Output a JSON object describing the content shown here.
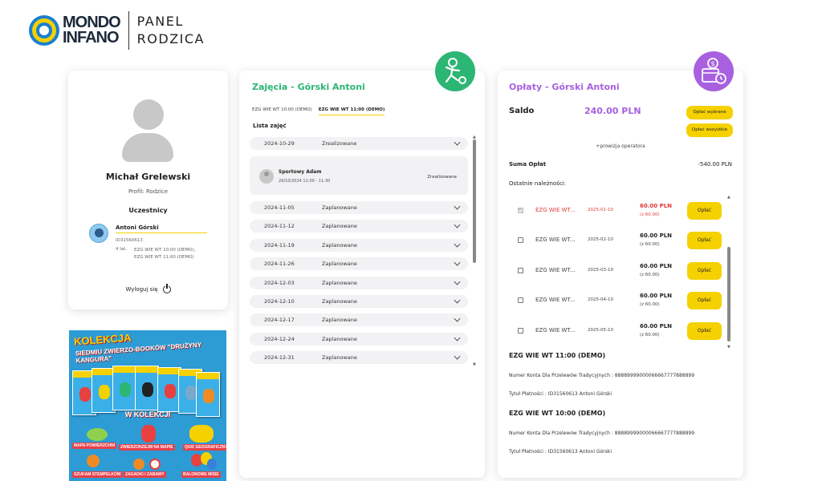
{
  "header": {
    "logo_line1": "MONDO",
    "logo_line2": "INFANO",
    "panel_line1": "PANEL",
    "panel_line2": "RODZICA"
  },
  "profile": {
    "name": "Michał Grelewski",
    "role": "Profil: Rodzice",
    "participants_label": "Uczestnicy",
    "child": {
      "name": "Antoni Górski",
      "id": "ID31560613",
      "age": "4 lat,",
      "groups_line1": "EZG WIE WT 10:00 (DEMO),",
      "groups_line2": "EZG WIE WT 11:00 (DEMO)"
    },
    "logout": "Wyloguj się"
  },
  "ad": {
    "title": "KOLEKCJA",
    "subtitle": "SIEDMIU ZWIERZO-BOOKÓW \"DRUŻYNY KANGURA\"",
    "in_collection": "W KOLEKCJI",
    "items": [
      "MAPA POWIERZCHNI",
      "ZWIERZONZEJM NA MAPIE",
      "QUIZ GEOGRAFICZNY",
      "SZUKAM STEMPELKÓW",
      "ZAGADKI I ZABAWY",
      "BALONOWE MISIE"
    ]
  },
  "classes": {
    "title": "Zajęcia - Górski Antoni",
    "tabs": [
      {
        "label": "EZG WIE WT 10:00 (DEMO)",
        "active": false
      },
      {
        "label": "EZG WIE WT 11:00 (DEMO)",
        "active": true
      }
    ],
    "list_label": "Lista zajęć",
    "expanded": {
      "teacher": "Sportowy Adam",
      "time": "29/10/2024 11:00 - 11:30",
      "status": "Zrealizowane"
    },
    "rows": [
      {
        "date": "2024-10-29",
        "status": "Zrealizowane"
      },
      {
        "date": "2024-11-05",
        "status": "Zaplanowane"
      },
      {
        "date": "2024-11-12",
        "status": "Zaplanowane"
      },
      {
        "date": "2024-11-19",
        "status": "Zaplanowane"
      },
      {
        "date": "2024-11-26",
        "status": "Zaplanowane"
      },
      {
        "date": "2024-12-03",
        "status": "Zaplanowane"
      },
      {
        "date": "2024-12-10",
        "status": "Zaplanowane"
      },
      {
        "date": "2024-12-17",
        "status": "Zaplanowane"
      },
      {
        "date": "2024-12-24",
        "status": "Zaplanowane"
      },
      {
        "date": "2024-12-31",
        "status": "Zaplanowane"
      }
    ]
  },
  "fees": {
    "title": "Opłaty - Górski Antoni",
    "saldo_label": "Saldo",
    "saldo_value": "240.00 PLN",
    "btn_selected": "Opłać wybrane",
    "btn_all": "Opłać wszystkie",
    "note": "+prowizja operatora",
    "suma_label": "Suma Opłat",
    "suma_value": "-540.00 PLN",
    "recent_label": "Ostatnie należności:",
    "pay_label": "Opłać",
    "items": [
      {
        "name": "EZG WIE WT...",
        "date": "2025-01-10",
        "amount": "60.00 PLN",
        "sub": "(z 60.00)",
        "checked": true,
        "overdue": true
      },
      {
        "name": "EZG WIE WT...",
        "date": "2025-02-10",
        "amount": "60.00 PLN",
        "sub": "(z 60.00)",
        "checked": false,
        "overdue": false
      },
      {
        "name": "EZG WIE WT...",
        "date": "2025-03-10",
        "amount": "60.00 PLN",
        "sub": "(z 60.00)",
        "checked": false,
        "overdue": false
      },
      {
        "name": "EZG WIE WT...",
        "date": "2025-04-10",
        "amount": "60.00 PLN",
        "sub": "(z 60.00)",
        "checked": false,
        "overdue": false
      },
      {
        "name": "EZG WIE WT...",
        "date": "2025-05-10",
        "amount": "60.00 PLN",
        "sub": "(z 60.00)",
        "checked": false,
        "overdue": false
      }
    ],
    "accounts": [
      {
        "heading": "EZG WIE WT 11:00 (DEMO)",
        "account": "Numer Konta Dla Przelewów Tradycyjnych : 88889999000066667777888899",
        "title": "Tytuł Płatności : ID31560613 Antoni Górski"
      },
      {
        "heading": "EZG WIE WT 10:00 (DEMO)",
        "account": "Numer Konta Dla Przelewów Tradycyjnych : 88889999000066667777888899",
        "title": "Tytuł Płatności : ID31560613 Antoni Górski"
      }
    ]
  },
  "colors": {
    "green": "#2bb673",
    "purple": "#a860e0",
    "yellow": "#f5d100",
    "red": "#e03a3a"
  },
  "icons": {
    "classes_badge": "kids-activity-icon",
    "fees_badge": "payment-calendar-icon"
  }
}
